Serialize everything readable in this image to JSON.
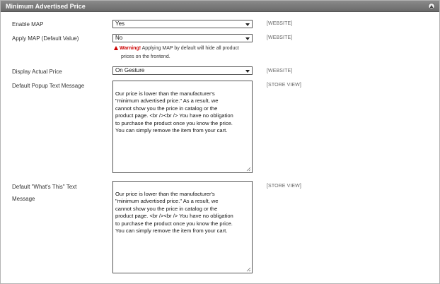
{
  "section": {
    "title": "Minimum Advertised Price",
    "collapse_icon": "collapse-up-icon"
  },
  "fields": {
    "enable_map": {
      "label": "Enable MAP",
      "value": "Yes",
      "scope": "[WEBSITE]"
    },
    "apply_map": {
      "label": "Apply MAP (Default Value)",
      "value": "No",
      "scope": "[WEBSITE]"
    },
    "warning": {
      "strong": "Warning!",
      "text_line1": " Applying MAP by default will hide all product",
      "text_line2": "prices on the frontend.",
      "icon": "warning-triangle-icon"
    },
    "display_actual_price": {
      "label": "Display Actual Price",
      "value": "On Gesture",
      "scope": "[WEBSITE]"
    },
    "popup_text": {
      "label": "Default Popup Text Message",
      "value": "Our price is lower than the manufacturer's\n\"minimum advertised price.\"  As a result, we\ncannot show you the price in catalog or the\nproduct page. <br /><br /> You have no obligation\nto purchase the product once you know the price.\nYou can simply remove the item from your cart.",
      "scope": "[STORE VIEW]"
    },
    "whats_this_text": {
      "label_line1": "Default \"What's This\" Text",
      "label_line2": "Message",
      "value": "Our price is lower than the manufacturer's\n\"minimum advertised price.\"  As a result, we\ncannot show you the price in catalog or the\nproduct page. <br /><br /> You have no obligation\nto purchase the product once you know the price.\nYou can simply remove the item from your cart.",
      "scope": "[STORE VIEW]"
    }
  },
  "colors": {
    "header_bg": "#7a7a7a",
    "warning_red": "#cc0000"
  }
}
